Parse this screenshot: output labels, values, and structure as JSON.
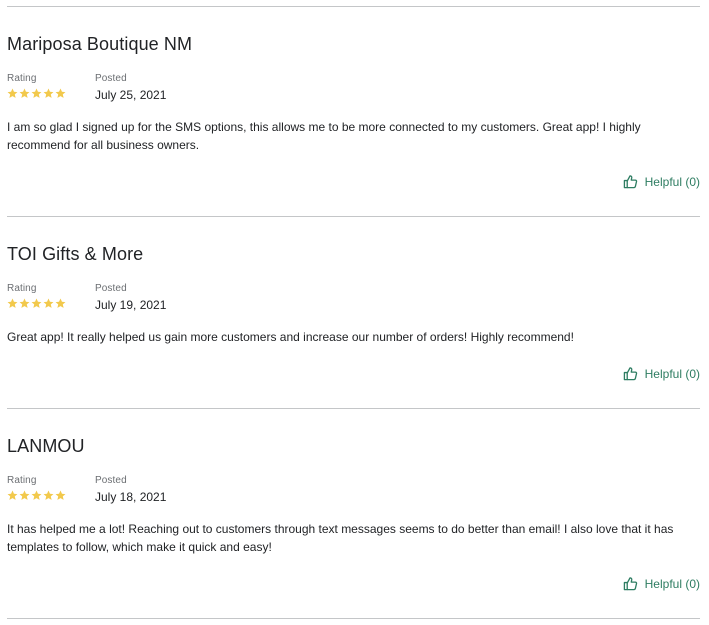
{
  "colors": {
    "star": "#f2c94c",
    "helpful": "#2e7d62",
    "divider": "#c4c6c8"
  },
  "icons": {
    "star": "star-icon",
    "thumbs_up": "thumbs-up-icon"
  },
  "reviews": [
    {
      "title": "Mariposa Boutique NM",
      "rating_label": "Rating",
      "posted_label": "Posted",
      "rating": 5,
      "date": "July 25, 2021",
      "body": "I am so glad I signed up for the SMS options, this allows me to be more connected to my customers. Great app! I highly recommend for all business owners.",
      "helpful": "Helpful (0)"
    },
    {
      "title": "TOI Gifts & More",
      "rating_label": "Rating",
      "posted_label": "Posted",
      "rating": 5,
      "date": "July 19, 2021",
      "body": "Great app! It really helped us gain more customers and increase our number of orders! Highly recommend!",
      "helpful": "Helpful (0)"
    },
    {
      "title": "LANMOU",
      "rating_label": "Rating",
      "posted_label": "Posted",
      "rating": 5,
      "date": "July 18, 2021",
      "body": "It has helped me a lot! Reaching out to customers through text messages seems to do better than email! I also love that it has templates to follow, which make it quick and easy!",
      "helpful": "Helpful (0)"
    }
  ]
}
